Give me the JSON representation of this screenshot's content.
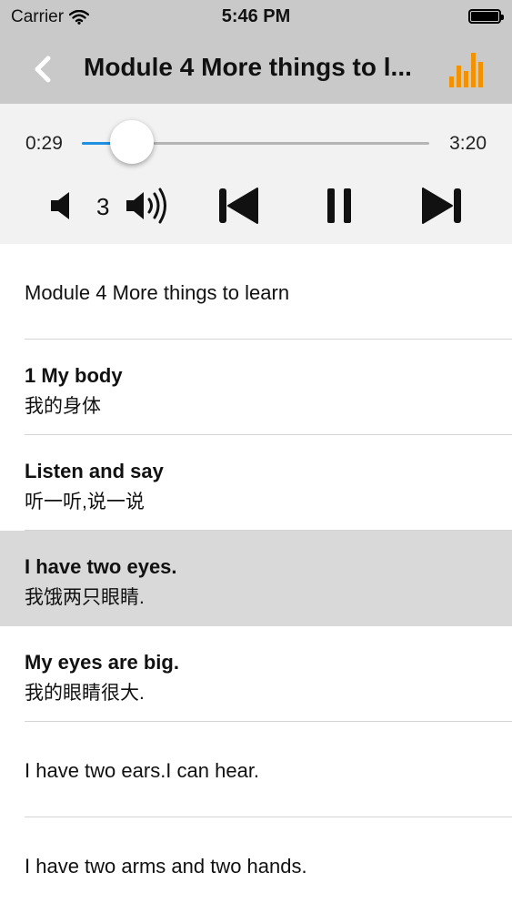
{
  "status": {
    "carrier": "Carrier",
    "time": "5:46 PM"
  },
  "nav": {
    "back_icon": "chevron-left-icon",
    "title": "Module 4 More things to l...",
    "menu_icon": "equalizer-icon",
    "accent": "#f39200"
  },
  "player": {
    "current_time": "0:29",
    "total_time": "3:20",
    "progress": 0.145,
    "volume": "3",
    "icons": [
      "volume-down-icon",
      "volume-up-icon",
      "skip-back-icon",
      "pause-icon",
      "skip-forward-icon"
    ],
    "progress_color": "#1f8fe0"
  },
  "lessons": [
    {
      "single": "Module 4 More things to learn"
    },
    {
      "en": "1 My body",
      "zh": "我的身体"
    },
    {
      "en": "Listen and say",
      "zh": "听一听,说一说"
    },
    {
      "en": "I have two eyes.",
      "zh": "我饿两只眼睛.",
      "highlighted": true
    },
    {
      "en": "My eyes are big.",
      "zh": "我的眼睛很大."
    },
    {
      "single": "I have two ears.I can hear."
    },
    {
      "single": "I have two arms and two hands."
    }
  ]
}
